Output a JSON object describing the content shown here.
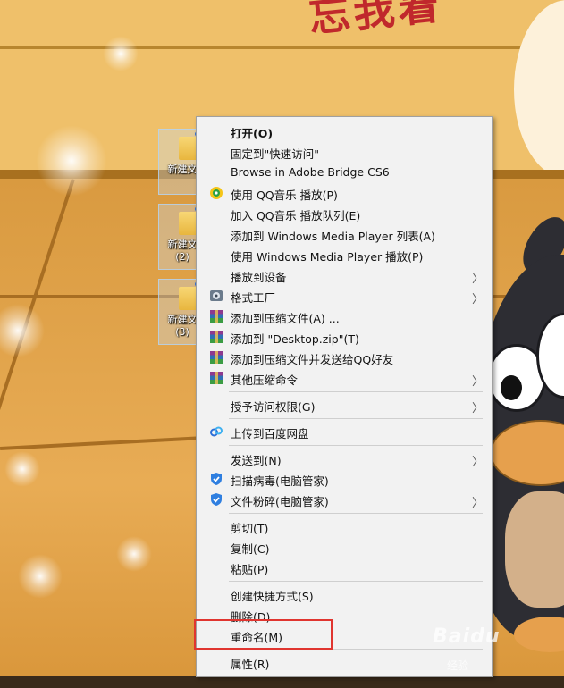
{
  "desktop": {
    "banner_text": "忘我着",
    "icons": [
      {
        "label": "新建文"
      },
      {
        "label": "新建文",
        "sub": "(2)"
      },
      {
        "label": "新建文",
        "sub": "(3)"
      }
    ]
  },
  "context_menu": {
    "items": [
      {
        "label": "打开(O)",
        "bold": true,
        "icon": "",
        "submenu": false
      },
      {
        "label": "固定到\"快速访问\"",
        "icon": "",
        "submenu": false
      },
      {
        "label": "Browse in Adobe Bridge CS6",
        "icon": "",
        "submenu": false
      },
      {
        "label": "使用 QQ音乐 播放(P)",
        "icon": "qq-music-icon",
        "submenu": false
      },
      {
        "label": "加入 QQ音乐 播放队列(E)",
        "icon": "",
        "submenu": false
      },
      {
        "label": "添加到 Windows Media Player 列表(A)",
        "icon": "",
        "submenu": false
      },
      {
        "label": "使用 Windows Media Player 播放(P)",
        "icon": "",
        "submenu": false
      },
      {
        "label": "播放到设备",
        "icon": "",
        "submenu": true
      },
      {
        "label": "格式工厂",
        "icon": "format-factory-icon",
        "submenu": true
      },
      {
        "label": "添加到压缩文件(A) ...",
        "icon": "winrar-icon",
        "submenu": false
      },
      {
        "label": "添加到 \"Desktop.zip\"(T)",
        "icon": "winrar-icon",
        "submenu": false
      },
      {
        "label": "添加到压缩文件并发送给QQ好友",
        "icon": "winrar-icon",
        "submenu": false
      },
      {
        "label": "其他压缩命令",
        "icon": "winrar-icon",
        "submenu": true
      },
      {
        "label": "授予访问权限(G)",
        "icon": "",
        "submenu": true
      },
      {
        "label": "上传到百度网盘",
        "icon": "baidu-netdisk-icon",
        "submenu": false
      },
      {
        "label": "发送到(N)",
        "icon": "",
        "submenu": true
      },
      {
        "label": "扫描病毒(电脑管家)",
        "icon": "pc-manager-shield-icon",
        "submenu": false
      },
      {
        "label": "文件粉碎(电脑管家)",
        "icon": "pc-manager-shield-icon",
        "submenu": true
      },
      {
        "label": "剪切(T)",
        "icon": "",
        "submenu": false
      },
      {
        "label": "复制(C)",
        "icon": "",
        "submenu": false
      },
      {
        "label": "粘贴(P)",
        "icon": "",
        "submenu": false
      },
      {
        "label": "创建快捷方式(S)",
        "icon": "",
        "submenu": false
      },
      {
        "label": "删除(D)",
        "icon": "",
        "submenu": false
      },
      {
        "label": "重命名(M)",
        "icon": "",
        "submenu": false
      },
      {
        "label": "属性(R)",
        "icon": "",
        "submenu": false
      }
    ]
  },
  "watermark": {
    "text": "Baidu",
    "sub": "经验"
  },
  "colors": {
    "highlight": "#e0352f",
    "menu_bg": "#f2f2f2"
  }
}
